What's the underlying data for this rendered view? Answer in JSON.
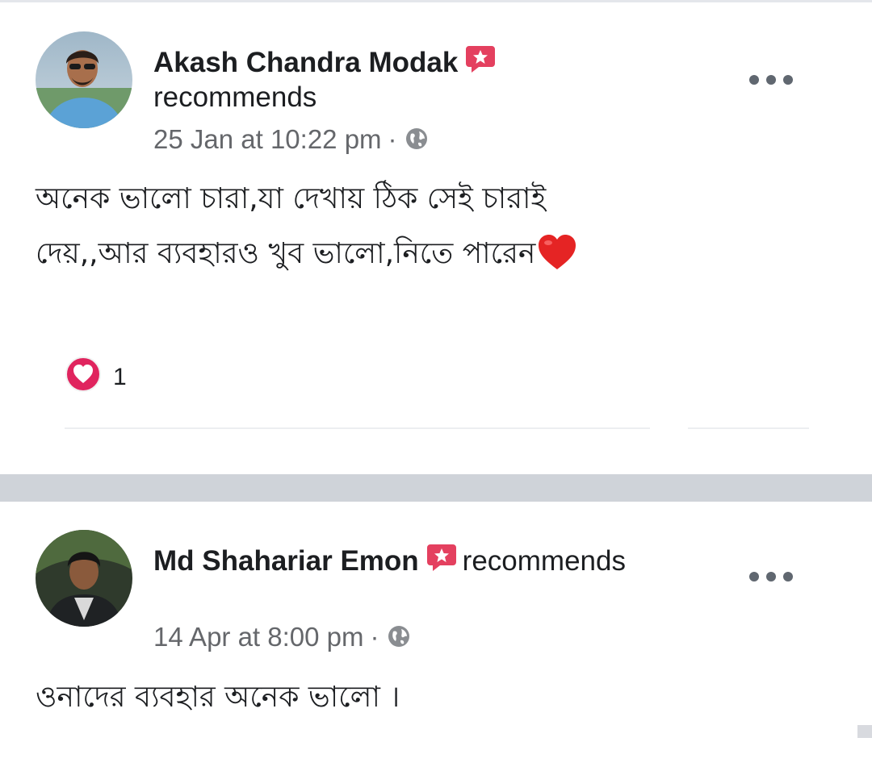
{
  "feed": {
    "posts": [
      {
        "author": "Akash Chandra Modak",
        "action": "recommends",
        "timestamp": "25 Jan at 10:22 pm",
        "separator": "·",
        "privacy_icon": "globe-icon",
        "text_line1": "অনেক ভালো চারা,যা দেখায় ঠিক সেই চারাই",
        "text_line2": "দেয়,,আর ব্যবহারও খুব ভালো,নিতে পারেন",
        "reaction_icon": "love-reaction-icon",
        "reaction_count": "1"
      },
      {
        "author": "Md Shahariar Emon",
        "action": "recommends",
        "timestamp": "14 Apr at 8:00 pm",
        "separator": "·",
        "privacy_icon": "globe-icon",
        "text_line1": "ওনাদের ব্যবহার অনেক ভালো ।"
      }
    ]
  },
  "colors": {
    "recommend_badge": "#e4405f",
    "reaction_red": "#e0245e",
    "meta_gray": "#65676b",
    "separator_band": "#cfd3d9"
  }
}
